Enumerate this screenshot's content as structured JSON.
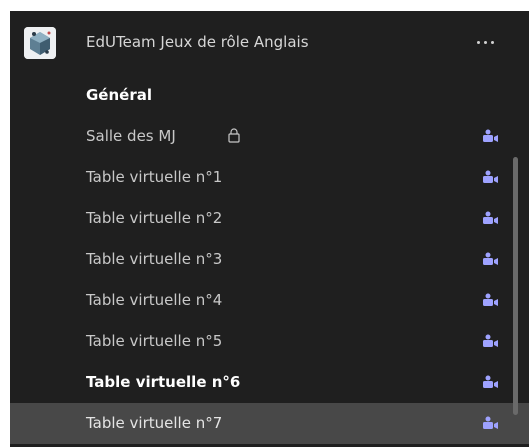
{
  "team": {
    "name": "EdUTeam Jeux de rôle Anglais",
    "more_icon": "more-horizontal-icon",
    "avatar_icon": "dice-logo-icon"
  },
  "channels": [
    {
      "label": "Général",
      "bold": true,
      "locked": false,
      "meeting": false
    },
    {
      "label": "Salle des MJ",
      "bold": false,
      "locked": true,
      "meeting": true
    },
    {
      "label": "Table virtuelle n°1",
      "bold": false,
      "locked": false,
      "meeting": true
    },
    {
      "label": "Table virtuelle n°2",
      "bold": false,
      "locked": false,
      "meeting": true
    },
    {
      "label": "Table virtuelle n°3",
      "bold": false,
      "locked": false,
      "meeting": true
    },
    {
      "label": "Table virtuelle n°4",
      "bold": false,
      "locked": false,
      "meeting": true
    },
    {
      "label": "Table virtuelle n°5",
      "bold": false,
      "locked": false,
      "meeting": true
    },
    {
      "label": "Table virtuelle n°6",
      "bold": true,
      "locked": false,
      "meeting": true
    },
    {
      "label": "Table virtuelle n°7",
      "bold": false,
      "locked": false,
      "meeting": true,
      "selected": true
    }
  ],
  "icons": {
    "lock": "lock-icon",
    "meeting": "meeting-in-progress-icon"
  },
  "colors": {
    "background": "#1f1f1f",
    "selected_row": "#484848",
    "meeting_icon": "#9ea2ff"
  }
}
